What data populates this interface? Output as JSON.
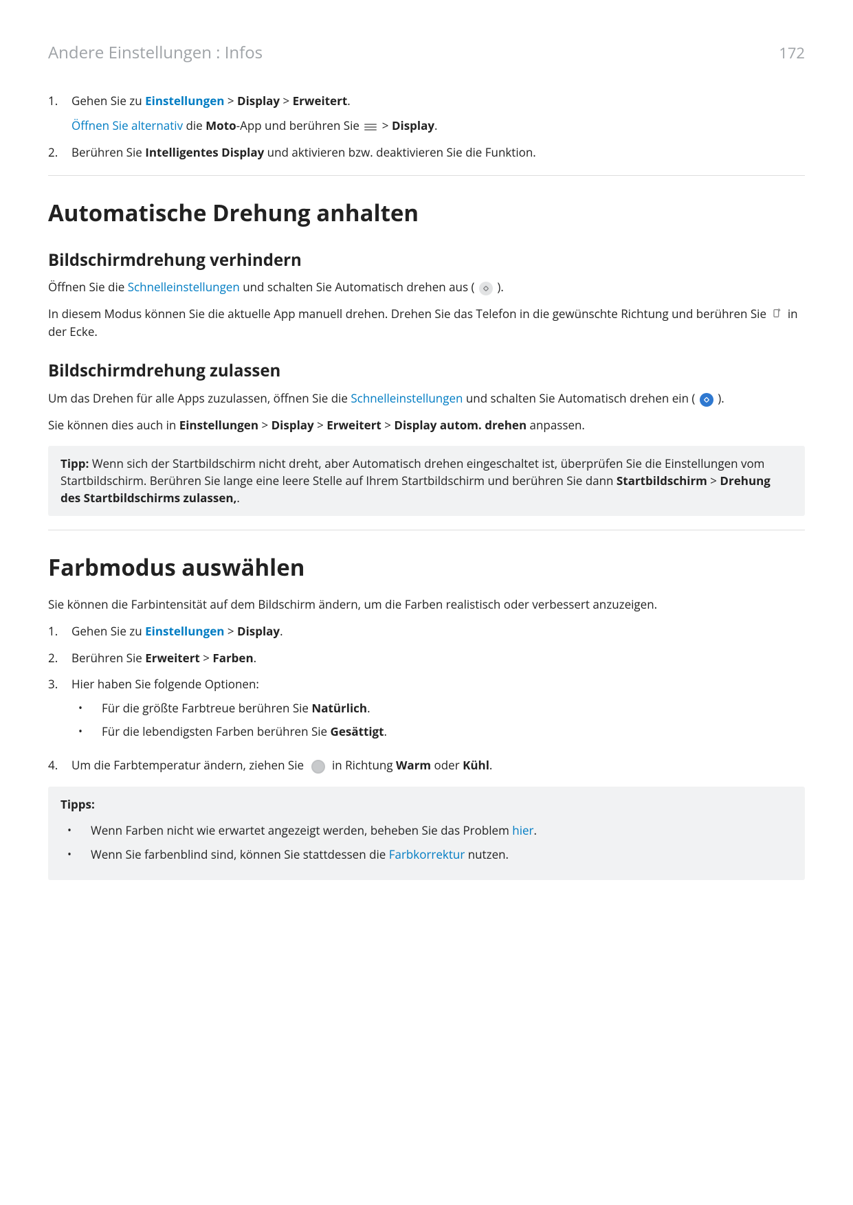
{
  "header": {
    "breadcrumb": "Andere Einstellungen : Infos",
    "page_number": "172"
  },
  "intro_list": {
    "item1": {
      "num": "1.",
      "text_prefix": "Gehen Sie zu ",
      "link_einstellungen": "Einstellungen",
      "gt1": " > ",
      "bold_display": "Display",
      "gt2": " > ",
      "bold_erweitert": "Erweitert",
      "period": ".",
      "alt_link": "Öffnen Sie alternativ",
      "alt_text1": " die ",
      "alt_bold_moto": "Moto",
      "alt_text2": "-App und berühren Sie ",
      "alt_gt": " > ",
      "alt_bold_display": "Display",
      "alt_period": "."
    },
    "item2": {
      "num": "2.",
      "text1": "Berühren Sie ",
      "bold1": "Intelligentes Display",
      "text2": " und aktivieren bzw. deaktivieren Sie die Funktion."
    }
  },
  "sec1": {
    "h1": "Automatische Drehung anhalten",
    "sub1": {
      "h2": "Bildschirmdrehung verhindern",
      "p1_a": "Öffnen Sie die ",
      "p1_link": "Schnelleinstellungen",
      "p1_b": " und schalten Sie Automatisch drehen aus ( ",
      "p1_c": " ).",
      "p2_a": "In diesem Modus können Sie die aktuelle App manuell drehen. Drehen Sie das Telefon in die gewünschte Richtung und berühren Sie ",
      "p2_b": " in der Ecke."
    },
    "sub2": {
      "h2": "Bildschirmdrehung zulassen",
      "p1_a": "Um das Drehen für alle Apps zuzulassen, öffnen Sie die ",
      "p1_link": "Schnelleinstellungen",
      "p1_b": " und schalten Sie Automatisch drehen ein (",
      "p1_c": ").",
      "p2_a": "Sie können dies auch in ",
      "p2_b1": "Einstellungen",
      "gt1": " > ",
      "p2_b2": "Display",
      "gt2": " > ",
      "p2_b3": "Erweitert",
      "gt3": " > ",
      "p2_b4": "Display autom. drehen",
      "p2_c": " anpassen."
    },
    "tipp": {
      "label": "Tipp: ",
      "t1": "Wenn sich der Startbildschirm nicht dreht, aber Automatisch drehen eingeschaltet ist, überprüfen Sie die Einstellungen vom Startbildschirm. Berühren Sie lange eine leere Stelle auf Ihrem Startbildschirm und berühren Sie dann ",
      "b1": "Startbildschirm",
      "gt": " > ",
      "b2": "Drehung des Startbildschirms zulassen,",
      "end": "."
    }
  },
  "sec2": {
    "h1": "Farbmodus auswählen",
    "intro": "Sie können die Farbintensität auf dem Bildschirm ändern, um die Farben realistisch oder verbessert anzuzeigen.",
    "list": {
      "i1": {
        "num": "1.",
        "a": "Gehen Sie zu ",
        "link": "Einstellungen",
        "gt": " > ",
        "b": "Display",
        "end": "."
      },
      "i2": {
        "num": "2.",
        "a": "Berühren Sie ",
        "b1": "Erweitert",
        "gt": " > ",
        "b2": "Farben",
        "end": "."
      },
      "i3": {
        "num": "3.",
        "a": "Hier haben Sie folgende Optionen:",
        "opt1_a": "Für die größte Farbtreue berühren Sie ",
        "opt1_b": "Natürlich",
        "opt1_end": ".",
        "opt2_a": "Für die lebendigsten Farben berühren Sie ",
        "opt2_b": "Gesättigt",
        "opt2_end": "."
      },
      "i4": {
        "num": "4.",
        "a": "Um die Farbtemperatur ändern, ziehen Sie ",
        "b": " in Richtung ",
        "b1": "Warm",
        "or": " oder ",
        "b2": "Kühl",
        "end": "."
      }
    },
    "tipps": {
      "label": "Tipps:",
      "t1_a": "Wenn Farben nicht wie erwartet angezeigt werden, beheben Sie das Problem ",
      "t1_link": "hier",
      "t1_end": ".",
      "t2_a": "Wenn Sie farbenblind sind, können Sie stattdessen die ",
      "t2_link": "Farbkorrektur",
      "t2_end": " nutzen."
    }
  }
}
